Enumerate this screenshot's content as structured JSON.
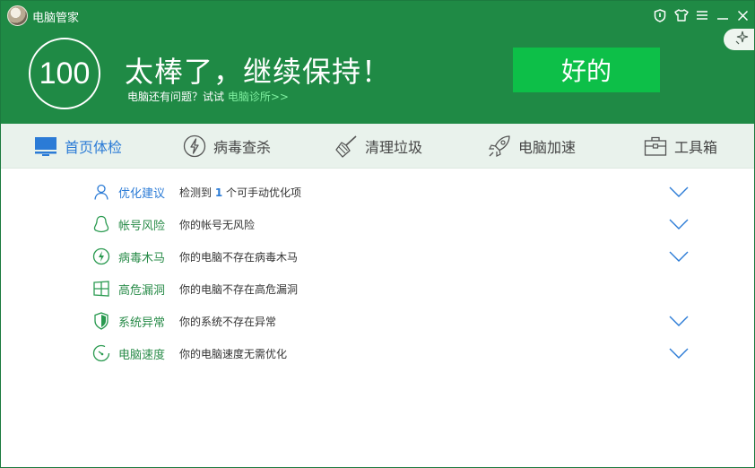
{
  "window": {
    "title": "电脑管家"
  },
  "header": {
    "score": "100",
    "headline": "太棒了，继续保持！",
    "sub_prefix": "电脑还有问题？试试 ",
    "sub_link": "电脑诊所>>",
    "ok_button": "好的"
  },
  "titlebar_icons": [
    "shield-icon",
    "tshirt-icon",
    "menu-icon",
    "minimize-icon",
    "close-icon"
  ],
  "nav": {
    "tabs": [
      {
        "label": "首页体检",
        "icon": "monitor-icon"
      },
      {
        "label": "病毒查杀",
        "icon": "lightning-icon"
      },
      {
        "label": "清理垃圾",
        "icon": "broom-icon"
      },
      {
        "label": "电脑加速",
        "icon": "rocket-icon"
      },
      {
        "label": "工具箱",
        "icon": "toolbox-icon"
      }
    ]
  },
  "checks": [
    {
      "label": "优化建议",
      "icon": "user-icon",
      "desc_pre": "检测到 ",
      "desc_num": "1",
      "desc_post": " 个可手动优化项",
      "expandable": true
    },
    {
      "label": "帐号风险",
      "icon": "penguin-icon",
      "desc": "你的帐号无风险",
      "expandable": true
    },
    {
      "label": "病毒木马",
      "icon": "virus-lightning-icon",
      "desc": "你的电脑不存在病毒木马",
      "expandable": true
    },
    {
      "label": "高危漏洞",
      "icon": "windows-icon",
      "desc": "你的电脑不存在高危漏洞",
      "expandable": false
    },
    {
      "label": "系统异常",
      "icon": "system-shield-icon",
      "desc": "你的系统不存在异常",
      "expandable": true
    },
    {
      "label": "电脑速度",
      "icon": "speed-icon",
      "desc": "你的电脑速度无需优化",
      "expandable": true
    }
  ],
  "colors": {
    "header_bg": "#1f8a45",
    "ok_button": "#0dbf48",
    "nav_bg": "#e9f2ec",
    "active_tab": "#2b7bd6",
    "item_label": "#2a8c4a"
  }
}
